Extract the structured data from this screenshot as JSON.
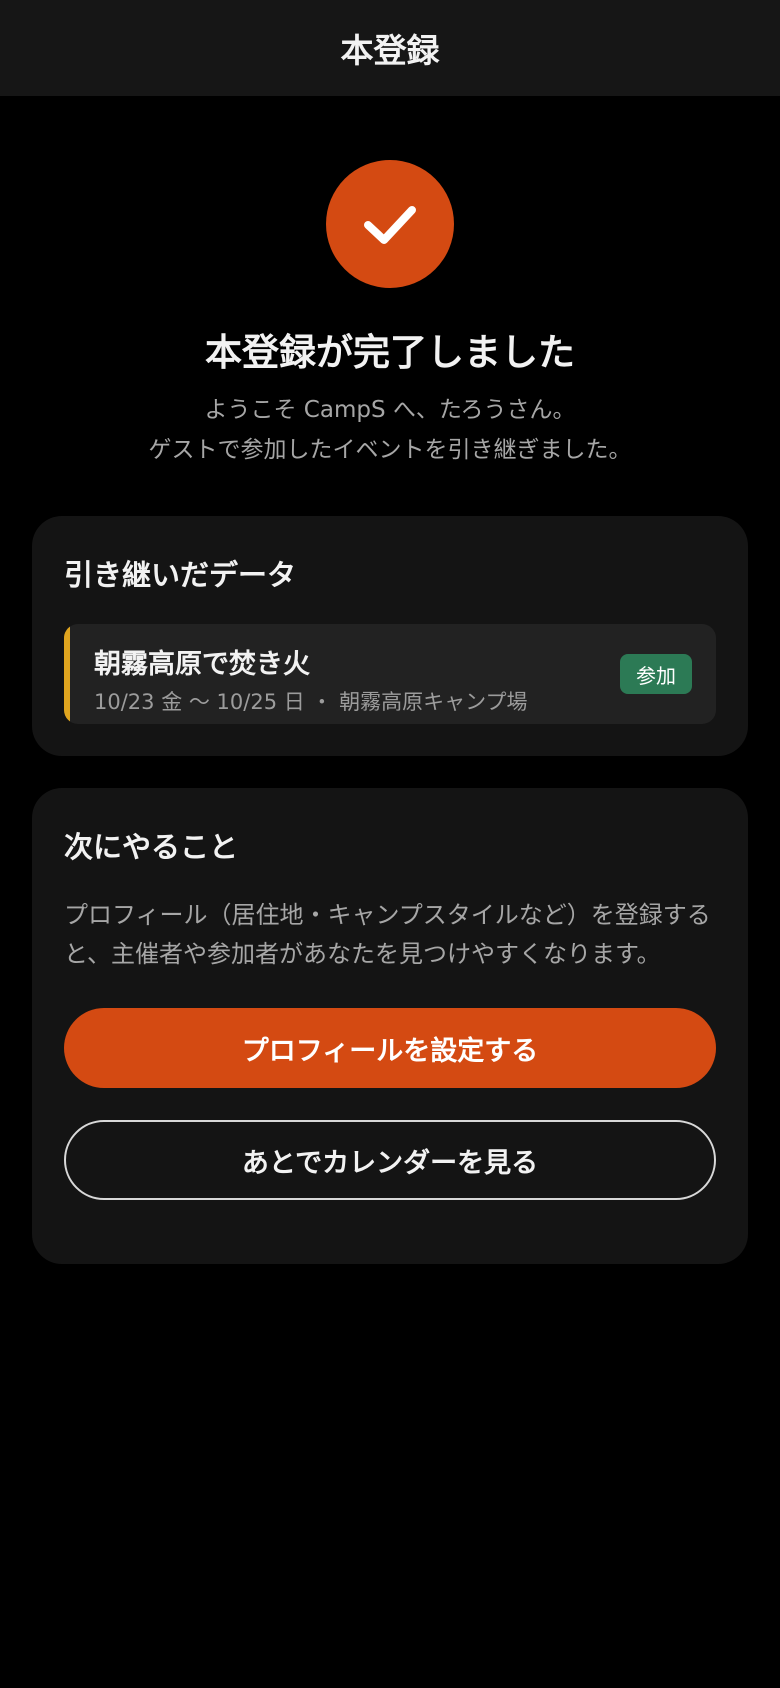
{
  "header": {
    "title": "本登録"
  },
  "success": {
    "icon": "check-icon",
    "accent_color": "#d44a12",
    "title": "本登録が完了しました",
    "message_line1": "ようこそ CampS へ、たろうさん。",
    "message_line2": "ゲストで参加したイベントを引き継ぎました。"
  },
  "inherited": {
    "title": "引き継いだデータ",
    "events": [
      {
        "name": "朝霧高原で焚き火",
        "meta": "10/23 金 〜 10/25 日 ・ 朝霧高原キャンプ場",
        "status": "参加",
        "status_color": "#2c7a55",
        "accent_color": "#e0a51f"
      }
    ]
  },
  "next": {
    "title": "次にやること",
    "description_line1": "プロフィール（居住地・キャンプスタイルなど）を登録する",
    "description_line2": "と、主催者や参加者があなたを見つけやすくなります。",
    "primary_button": "プロフィールを設定する",
    "secondary_button": "あとでカレンダーを見る"
  }
}
